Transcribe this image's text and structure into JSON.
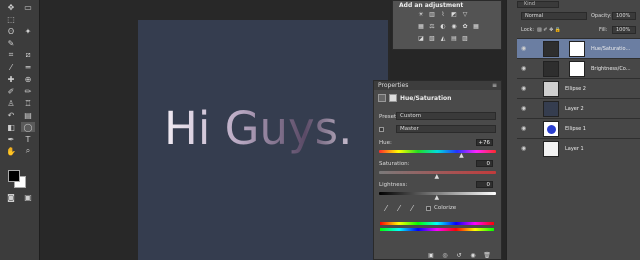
{
  "canvas": {
    "headline": "Hi Guys."
  },
  "adjustments": {
    "title": "Add an adjustment",
    "row1_icons": [
      "brightness-contrast-icon",
      "levels-icon",
      "curves-icon",
      "exposure-icon",
      "vibrance-icon"
    ],
    "row2_icons": [
      "hue-saturation-icon",
      "color-balance-icon",
      "black-white-icon",
      "photo-filter-icon",
      "channel-mixer-icon",
      "color-lookup-icon"
    ],
    "row3_icons": [
      "invert-icon",
      "posterize-icon",
      "threshold-icon",
      "selective-color-icon",
      "gradient-map-icon"
    ]
  },
  "properties": {
    "tab_label": "Properties",
    "layer_type": "Hue/Saturation",
    "preset_label": "Preset:",
    "preset_value": "Custom",
    "channel_value": "Master",
    "hue_label": "Hue:",
    "hue_value": "+76",
    "saturation_label": "Saturation:",
    "saturation_value": "0",
    "lightness_label": "Lightness:",
    "lightness_value": "0",
    "colorize_label": "Colorize",
    "hue_fraction": 0.71,
    "saturation_fraction": 0.5,
    "lightness_fraction": 0.5
  },
  "layers": {
    "search_placeholder": "Kind",
    "blend_mode": "Normal",
    "opacity_label": "Opacity:",
    "opacity_value": "100%",
    "lock_label": "Lock:",
    "fill_label": "Fill:",
    "fill_value": "100%",
    "items": [
      {
        "name": "Hue/Saturatio...",
        "thumb_color": "#2e2e2e",
        "selected": true
      },
      {
        "name": "Brightness/Co...",
        "thumb_color": "#2e2e2e",
        "selected": false
      },
      {
        "name": "Ellipse 2",
        "thumb_color": "#cfcfcf",
        "selected": false
      },
      {
        "name": "Layer 2",
        "thumb_color": "#353d4f",
        "selected": false
      },
      {
        "name": "Ellipse 1",
        "thumb_color": "#2b3fcf",
        "selected": false
      },
      {
        "name": "Layer 1",
        "thumb_color": "#f2f2f2",
        "selected": false
      }
    ]
  },
  "toolbar": {
    "foreground_color": "#000000",
    "background_color": "#ffffff"
  }
}
